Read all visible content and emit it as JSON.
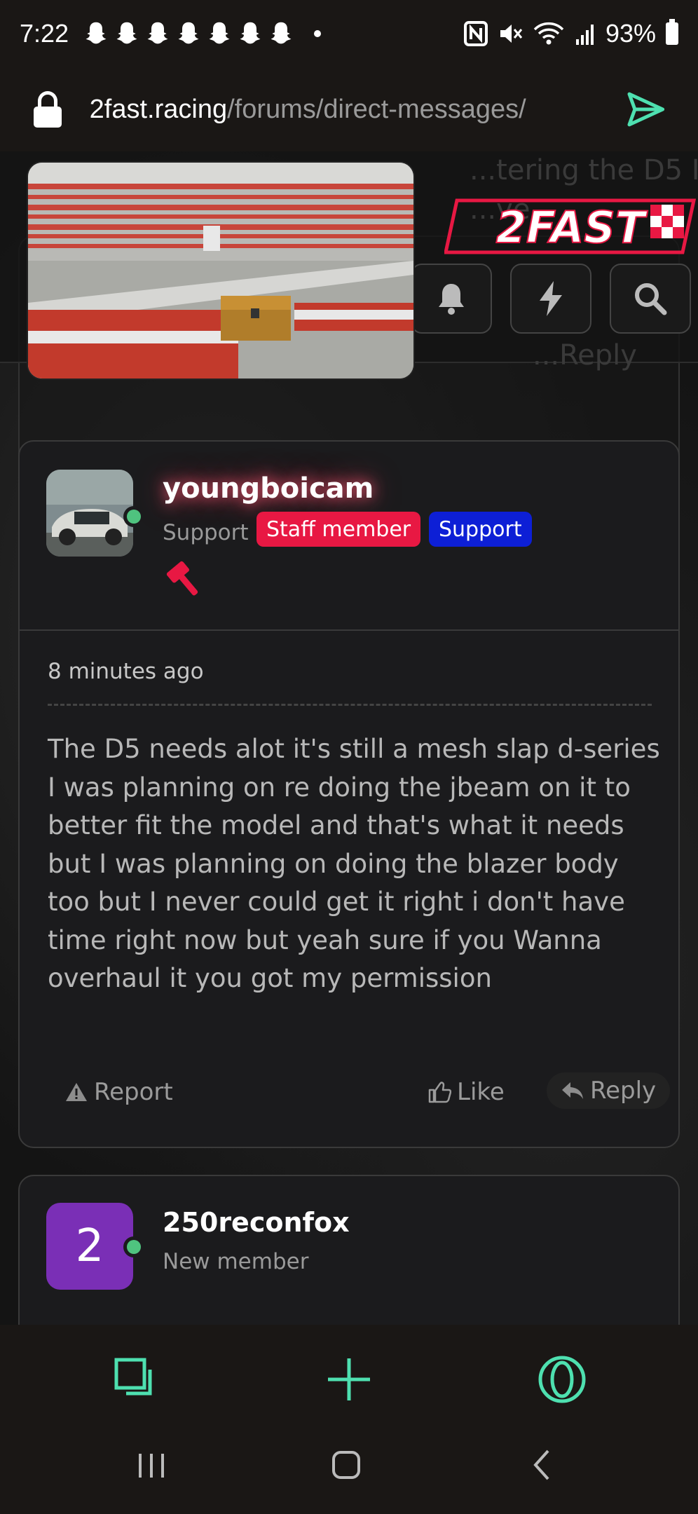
{
  "status": {
    "time": "7:22",
    "battery": "93%"
  },
  "browser": {
    "url_host": "2fast.racing",
    "url_path": "/forums/direct-messages/"
  },
  "background_text": [
    "...tering the D5 I",
    "...ve",
    "...Reply"
  ],
  "site": {
    "logo": "2FAST"
  },
  "post": {
    "username": "youngboicam",
    "user_title": "Support",
    "badges": {
      "staff": "Staff member",
      "support": "Support"
    },
    "time": "8 minutes ago",
    "message": "The D5 needs alot it's still a mesh slap d-series I was planning on re doing the jbeam on it to better fit the model and that's what it needs but I was planning on doing the blazer body too but I never could get it right i don't have time right now but yeah sure if you Wanna overhaul it you got my permission",
    "actions": {
      "report": "Report",
      "like": "Like",
      "reply": "Reply"
    }
  },
  "next_post": {
    "avatar_letter": "2",
    "username": "250reconfox",
    "user_title": "New member"
  },
  "colors": {
    "accent": "#4ee0b0",
    "staff_badge": "#e81843",
    "support_badge": "#0d1fd6",
    "online": "#4fc37f"
  }
}
